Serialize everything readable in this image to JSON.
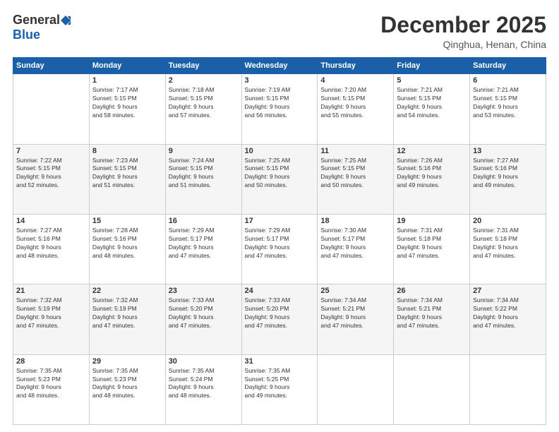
{
  "logo": {
    "general": "General",
    "blue": "Blue"
  },
  "header": {
    "month": "December 2025",
    "location": "Qinghua, Henan, China"
  },
  "weekdays": [
    "Sunday",
    "Monday",
    "Tuesday",
    "Wednesday",
    "Thursday",
    "Friday",
    "Saturday"
  ],
  "weeks": [
    [
      {
        "day": "",
        "info": ""
      },
      {
        "day": "1",
        "info": "Sunrise: 7:17 AM\nSunset: 5:15 PM\nDaylight: 9 hours\nand 58 minutes."
      },
      {
        "day": "2",
        "info": "Sunrise: 7:18 AM\nSunset: 5:15 PM\nDaylight: 9 hours\nand 57 minutes."
      },
      {
        "day": "3",
        "info": "Sunrise: 7:19 AM\nSunset: 5:15 PM\nDaylight: 9 hours\nand 56 minutes."
      },
      {
        "day": "4",
        "info": "Sunrise: 7:20 AM\nSunset: 5:15 PM\nDaylight: 9 hours\nand 55 minutes."
      },
      {
        "day": "5",
        "info": "Sunrise: 7:21 AM\nSunset: 5:15 PM\nDaylight: 9 hours\nand 54 minutes."
      },
      {
        "day": "6",
        "info": "Sunrise: 7:21 AM\nSunset: 5:15 PM\nDaylight: 9 hours\nand 53 minutes."
      }
    ],
    [
      {
        "day": "7",
        "info": "Sunrise: 7:22 AM\nSunset: 5:15 PM\nDaylight: 9 hours\nand 52 minutes."
      },
      {
        "day": "8",
        "info": "Sunrise: 7:23 AM\nSunset: 5:15 PM\nDaylight: 9 hours\nand 51 minutes."
      },
      {
        "day": "9",
        "info": "Sunrise: 7:24 AM\nSunset: 5:15 PM\nDaylight: 9 hours\nand 51 minutes."
      },
      {
        "day": "10",
        "info": "Sunrise: 7:25 AM\nSunset: 5:15 PM\nDaylight: 9 hours\nand 50 minutes."
      },
      {
        "day": "11",
        "info": "Sunrise: 7:25 AM\nSunset: 5:15 PM\nDaylight: 9 hours\nand 50 minutes."
      },
      {
        "day": "12",
        "info": "Sunrise: 7:26 AM\nSunset: 5:16 PM\nDaylight: 9 hours\nand 49 minutes."
      },
      {
        "day": "13",
        "info": "Sunrise: 7:27 AM\nSunset: 5:16 PM\nDaylight: 9 hours\nand 49 minutes."
      }
    ],
    [
      {
        "day": "14",
        "info": "Sunrise: 7:27 AM\nSunset: 5:16 PM\nDaylight: 9 hours\nand 48 minutes."
      },
      {
        "day": "15",
        "info": "Sunrise: 7:28 AM\nSunset: 5:16 PM\nDaylight: 9 hours\nand 48 minutes."
      },
      {
        "day": "16",
        "info": "Sunrise: 7:29 AM\nSunset: 5:17 PM\nDaylight: 9 hours\nand 47 minutes."
      },
      {
        "day": "17",
        "info": "Sunrise: 7:29 AM\nSunset: 5:17 PM\nDaylight: 9 hours\nand 47 minutes."
      },
      {
        "day": "18",
        "info": "Sunrise: 7:30 AM\nSunset: 5:17 PM\nDaylight: 9 hours\nand 47 minutes."
      },
      {
        "day": "19",
        "info": "Sunrise: 7:31 AM\nSunset: 5:18 PM\nDaylight: 9 hours\nand 47 minutes."
      },
      {
        "day": "20",
        "info": "Sunrise: 7:31 AM\nSunset: 5:18 PM\nDaylight: 9 hours\nand 47 minutes."
      }
    ],
    [
      {
        "day": "21",
        "info": "Sunrise: 7:32 AM\nSunset: 5:19 PM\nDaylight: 9 hours\nand 47 minutes."
      },
      {
        "day": "22",
        "info": "Sunrise: 7:32 AM\nSunset: 5:19 PM\nDaylight: 9 hours\nand 47 minutes."
      },
      {
        "day": "23",
        "info": "Sunrise: 7:33 AM\nSunset: 5:20 PM\nDaylight: 9 hours\nand 47 minutes."
      },
      {
        "day": "24",
        "info": "Sunrise: 7:33 AM\nSunset: 5:20 PM\nDaylight: 9 hours\nand 47 minutes."
      },
      {
        "day": "25",
        "info": "Sunrise: 7:34 AM\nSunset: 5:21 PM\nDaylight: 9 hours\nand 47 minutes."
      },
      {
        "day": "26",
        "info": "Sunrise: 7:34 AM\nSunset: 5:21 PM\nDaylight: 9 hours\nand 47 minutes."
      },
      {
        "day": "27",
        "info": "Sunrise: 7:34 AM\nSunset: 5:22 PM\nDaylight: 9 hours\nand 47 minutes."
      }
    ],
    [
      {
        "day": "28",
        "info": "Sunrise: 7:35 AM\nSunset: 5:23 PM\nDaylight: 9 hours\nand 48 minutes."
      },
      {
        "day": "29",
        "info": "Sunrise: 7:35 AM\nSunset: 5:23 PM\nDaylight: 9 hours\nand 48 minutes."
      },
      {
        "day": "30",
        "info": "Sunrise: 7:35 AM\nSunset: 5:24 PM\nDaylight: 9 hours\nand 48 minutes."
      },
      {
        "day": "31",
        "info": "Sunrise: 7:35 AM\nSunset: 5:25 PM\nDaylight: 9 hours\nand 49 minutes."
      },
      {
        "day": "",
        "info": ""
      },
      {
        "day": "",
        "info": ""
      },
      {
        "day": "",
        "info": ""
      }
    ]
  ]
}
